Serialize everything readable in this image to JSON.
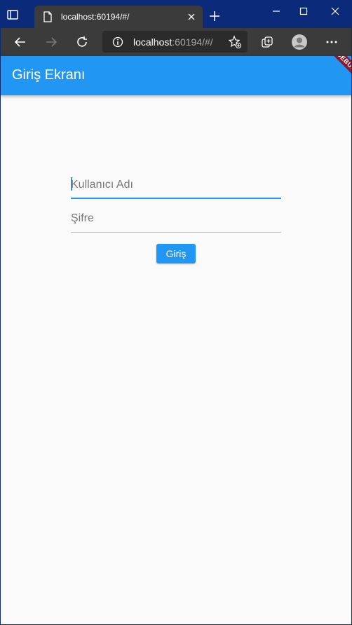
{
  "browser": {
    "tab_title": "localhost:60194/#/",
    "address_host": "localhost",
    "address_rest": ":60194/#/"
  },
  "app": {
    "title": "Giriş Ekranı",
    "debug_banner": "DEBUG",
    "username_label": "Kullanıcı Adı",
    "password_label": "Şifre",
    "login_button": "Giriş"
  },
  "colors": {
    "primary": "#2196f3",
    "debug": "#8b1a2d",
    "titlebar": "#0b2b7a"
  }
}
